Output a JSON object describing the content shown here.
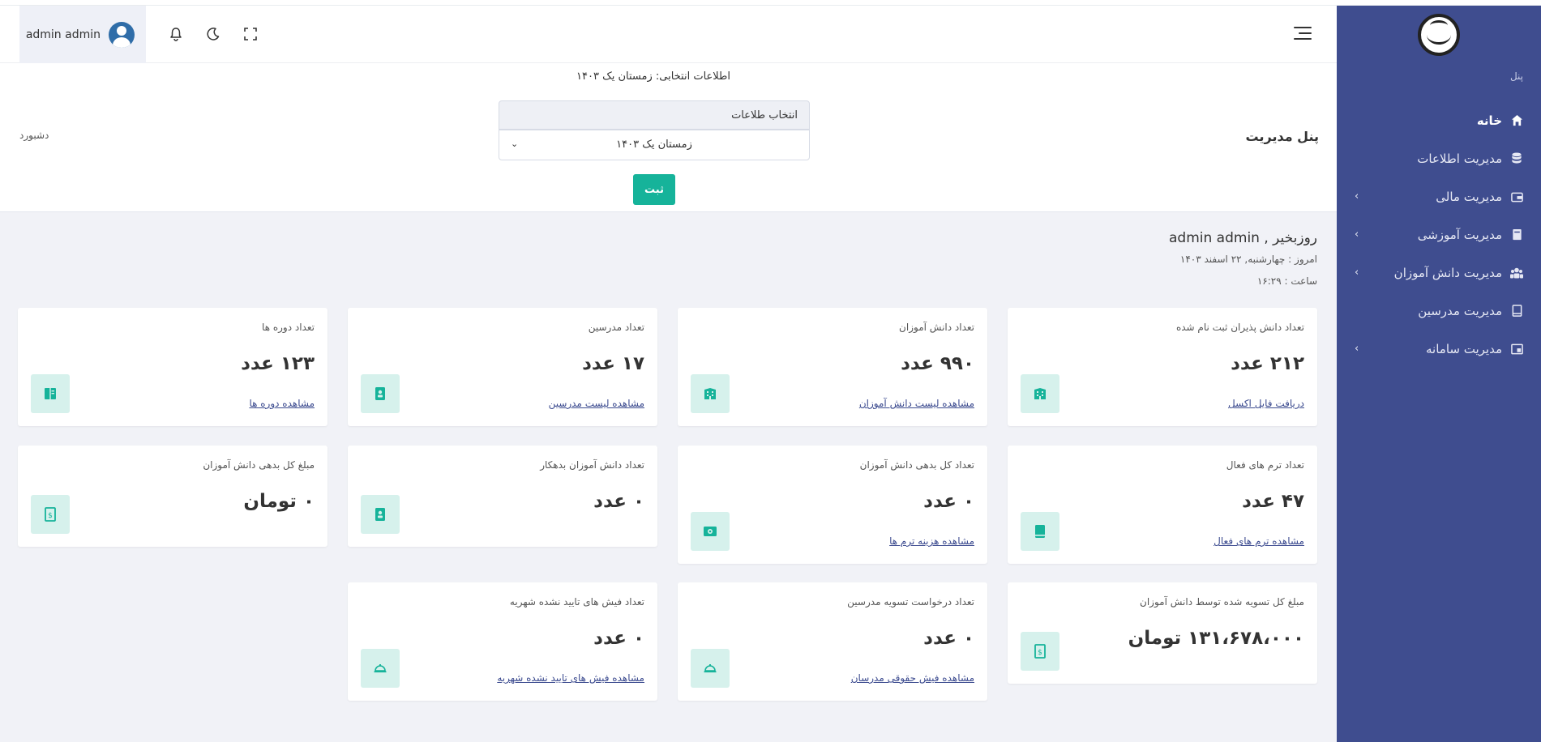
{
  "header": {
    "user_name": "admin admin"
  },
  "sidebar": {
    "section_label": "پنل",
    "items": [
      {
        "label": "خانه",
        "icon": "home-icon",
        "has_children": false,
        "active": true
      },
      {
        "label": "مدیریت اطلاعات",
        "icon": "database-icon",
        "has_children": false
      },
      {
        "label": "مدیریت مالی",
        "icon": "wallet-icon",
        "has_children": true
      },
      {
        "label": "مدیریت آموزشی",
        "icon": "book-icon",
        "has_children": true
      },
      {
        "label": "مدیریت دانش آموزان",
        "icon": "users-icon",
        "has_children": true
      },
      {
        "label": "مدیریت مدرسین",
        "icon": "teacher-book-icon",
        "has_children": false
      },
      {
        "label": "مدیریت سامانه",
        "icon": "system-window-icon",
        "has_children": true
      }
    ]
  },
  "panel": {
    "selected_info": "اطلاعات انتخابی: زمستان یک ۱۴۰۳",
    "select_label": "انتخاب طلاعات",
    "select_value": "زمستان یک ۱۴۰۳",
    "submit_label": "ثبت",
    "title": "پنل مدیریت",
    "breadcrumb": "دشبورد"
  },
  "welcome": {
    "greeting": "روزبخیر , admin admin",
    "today": "امروز : چهارشنبه, ۲۲ اسفند ۱۴۰۳",
    "clock": "ساعت : ۱۶:۲۹"
  },
  "cards": [
    {
      "title": "تعداد دانش پذیران ثبت نام شده",
      "value": "۲۱۲ عدد",
      "link": "دریافت فایل اکسل",
      "icon": "building-icon"
    },
    {
      "title": "تعداد دانش آموزان",
      "value": "۹۹۰ عدد",
      "link": "مشاهده لیست دانش آموزان",
      "icon": "building-icon"
    },
    {
      "title": "تعداد مدرسین",
      "value": "۱۷ عدد",
      "link": "مشاهده لیست مدرسین",
      "icon": "contact-book-icon"
    },
    {
      "title": "تعداد دوره ها",
      "value": "۱۲۳ عدد",
      "link": "مشاهده دوره ها",
      "icon": "open-book-icon"
    },
    {
      "title": "تعداد ترم های فعال",
      "value": "۴۷ عدد",
      "link": "مشاهده ترم های فعال",
      "icon": "book-icon"
    },
    {
      "title": "تعداد کل بدهی دانش آموزان",
      "value": "۰ عدد",
      "link": "مشاهده هزینه ترم ها",
      "icon": "money-icon"
    },
    {
      "title": "تعداد دانش آموزان بدهکار",
      "value": "۰ عدد",
      "link": "",
      "icon": "contact-book-icon"
    },
    {
      "title": "مبلغ کل بدهی دانش آموزان",
      "value": "۰ تومان",
      "link": "",
      "icon": "cash-icon"
    },
    {
      "title": "مبلغ کل تسویه شده توسط دانش آموزان",
      "value": "۱۳۱،۶۷۸،۰۰۰ تومان",
      "link": "",
      "icon": "cash-icon"
    },
    {
      "title": "تعداد درخواست تسویه مدرسین",
      "value": "۰ عدد",
      "link": "مشاهده فیش حقوقی مدرسان",
      "icon": "bell-service-icon"
    },
    {
      "title": "تعداد فیش های تایید نشده شهریه",
      "value": "۰ عدد",
      "link": "مشاهده فیش های تایید نشده شهریه",
      "icon": "bell-service-icon"
    }
  ],
  "colors": {
    "sidebar_bg": "#3f4d8f",
    "accent": "#16b39a",
    "content_bg": "#f1f2f7",
    "icon_bg": "#d6f1ec"
  }
}
